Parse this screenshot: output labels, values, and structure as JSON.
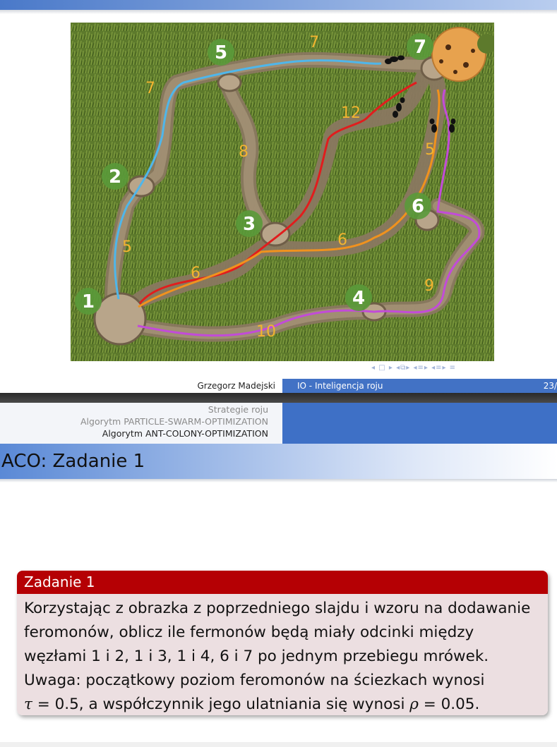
{
  "figure": {
    "nodes": [
      "1",
      "2",
      "3",
      "4",
      "5",
      "6",
      "7"
    ],
    "edge_weights": [
      "5",
      "7",
      "7",
      "8",
      "12",
      "5",
      "6",
      "6",
      "9",
      "10"
    ]
  },
  "footer": {
    "author": "Grzegorz Madejski",
    "title": "IO - Inteligencja roju",
    "page": "23/"
  },
  "header": {
    "sections": [
      "Strategie roju",
      "Algorytm PARTICLE-SWARM-OPTIMIZATION",
      "Algorytm ANT-COLONY-OPTIMIZATION"
    ]
  },
  "frame": {
    "title": "ACO: Zadanie 1"
  },
  "block": {
    "title": "Zadanie 1",
    "lines": [
      "Korzystając z obrazka z poprzedniego slajdu i wzoru na dodawanie",
      "feromonów, oblicz ile fermonów będą miały odcinki między",
      "węzłami 1 i 2, 1 i 3, 1 i 4, 6 i 7 po jednym przebiegu mrówek.",
      "Uwaga: początkowy poziom feromonów na ściezkach wynosi"
    ],
    "last_line_part1": "= 0.5, a współczynnik jego ulatniania się wynosi",
    "tau_symbol": "τ",
    "rho_symbol": "ρ",
    "last_line_part2": "= 0.05."
  },
  "colors": {
    "accent_blue": "#4272c5",
    "block_red": "#b50004",
    "block_body": "#ecdfe1",
    "path_blue": "#4fb6ea",
    "path_red": "#e11d1d",
    "path_orange": "#f0921e",
    "path_purple": "#c24bd8",
    "label_yellow": "#f2b430",
    "node_green": "#5a9a3a"
  },
  "icons": [
    "nav-prev-icon",
    "nav-frame-icon",
    "nav-next-icon",
    "nav-subsection-icon",
    "nav-section-icon",
    "search-icon"
  ]
}
